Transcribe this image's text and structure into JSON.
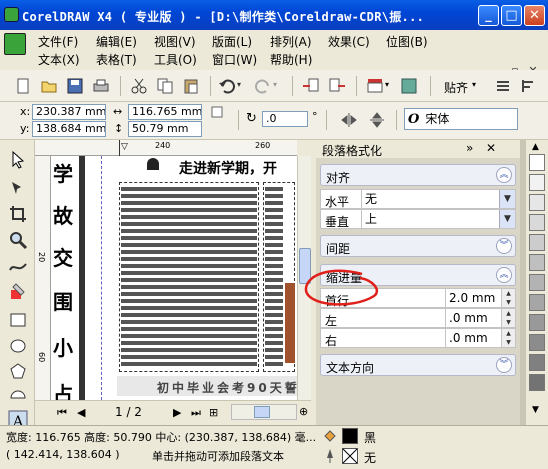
{
  "window": {
    "title": "CorelDRAW X4 ( 专业版 ) - [D:\\制作类\\Coreldraw-CDR\\振...",
    "minimize": "_",
    "maximize": "□",
    "close": "✕"
  },
  "menubar": {
    "row1": [
      "文件(F)",
      "编辑(E)",
      "视图(V)",
      "版面(L)",
      "排列(A)",
      "效果(C)",
      "位图(B)"
    ],
    "row2": [
      "文本(X)",
      "表格(T)",
      "工具(O)",
      "窗口(W)",
      "帮助(H)"
    ]
  },
  "standard_toolbar": {
    "snap_label": "贴齐",
    "icons": [
      "new-icon",
      "open-icon",
      "save-icon",
      "print-icon",
      "cut-icon",
      "copy-icon",
      "paste-icon",
      "undo-icon",
      "redo-icon",
      "import-icon",
      "export-icon",
      "app-launcher-icon",
      "welcome-icon"
    ]
  },
  "property_bar": {
    "x_label": "x:",
    "y_label": "y:",
    "x_value": "230.387 mm",
    "y_value": "138.684 mm",
    "width_value": "116.765 mm",
    "height_value": "50.79 mm",
    "rotation_value": ".0",
    "degree_symbol": "°",
    "font_icon_letter": "O",
    "font_name": "宋体"
  },
  "canvas": {
    "ruler_marks_h": [
      "240",
      "260"
    ],
    "ruler_marks_v": [
      "20",
      "60"
    ],
    "headline": "走进新学期，开",
    "footer_text": "初中毕业会考90天誓",
    "vertical_chars": [
      "学",
      "故",
      "交",
      "围",
      "小",
      "占"
    ],
    "page_indicator": "1 / 2"
  },
  "docker": {
    "title": "段落格式化",
    "sections": {
      "alignment": {
        "label": "对齐",
        "horizontal_label": "水平",
        "horizontal_value": "无",
        "vertical_label": "垂直",
        "vertical_value": "上"
      },
      "spacing": {
        "label": "间距"
      },
      "indent": {
        "label": "缩进量",
        "first_line_label": "首行",
        "first_line_value": "2.0 mm",
        "left_label": "左",
        "left_value": ".0 mm",
        "right_label": "右",
        "right_value": ".0 mm"
      },
      "text_direction": {
        "label": "文本方向"
      }
    },
    "colors": {
      "annotation": "#e0201a",
      "section_bg": "#eef0f7"
    }
  },
  "palette": {
    "colors": [
      "#ffffff",
      "#f2f2f2",
      "#e6e6e6",
      "#d9d9d9",
      "#cccccc",
      "#bfbfbf",
      "#b3b3b3",
      "#a6a6a6",
      "#999999",
      "#8c8c8c",
      "#808080",
      "#737373"
    ]
  },
  "status": {
    "size_info": "宽度: 116.765 高度: 50.790 中心: (230.387, 138.684) 毫...",
    "cursor_info": "( 142.414, 138.604 )",
    "hint": "单击并拖动可添加段落文本",
    "fill_label": "黑",
    "outline_label": "无"
  }
}
